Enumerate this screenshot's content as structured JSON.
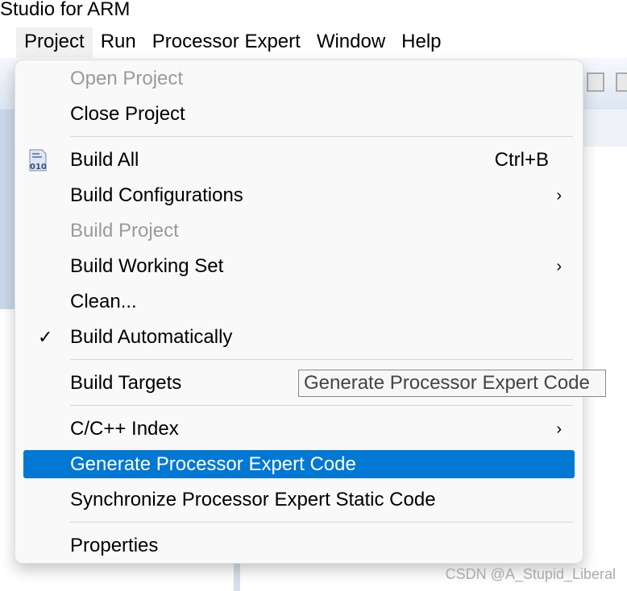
{
  "window": {
    "title": "Studio for ARM"
  },
  "menubar": [
    "Project",
    "Run",
    "Processor Expert",
    "Window",
    "Help"
  ],
  "menu": {
    "open_project": "Open Project",
    "close_project": "Close Project",
    "build_all": "Build All",
    "build_all_shortcut": "Ctrl+B",
    "build_configurations": "Build Configurations",
    "build_project": "Build Project",
    "build_working_set": "Build Working Set",
    "clean": "Clean...",
    "build_automatically": "Build Automatically",
    "build_automatically_checked": true,
    "build_targets": "Build Targets",
    "cc_index": "C/C++ Index",
    "generate_pe_code": "Generate Processor Expert Code",
    "sync_pe_static": "Synchronize Processor Expert Static Code",
    "properties": "Properties",
    "submenu_arrow": "›",
    "check": "✓",
    "build_all_icon_text": "010"
  },
  "tooltip": "Generate Processor Expert Code",
  "watermark": "CSDN @A_Stupid_Liberal",
  "colors": {
    "highlight": "#0078d4",
    "disabled": "#9a9a9a"
  }
}
